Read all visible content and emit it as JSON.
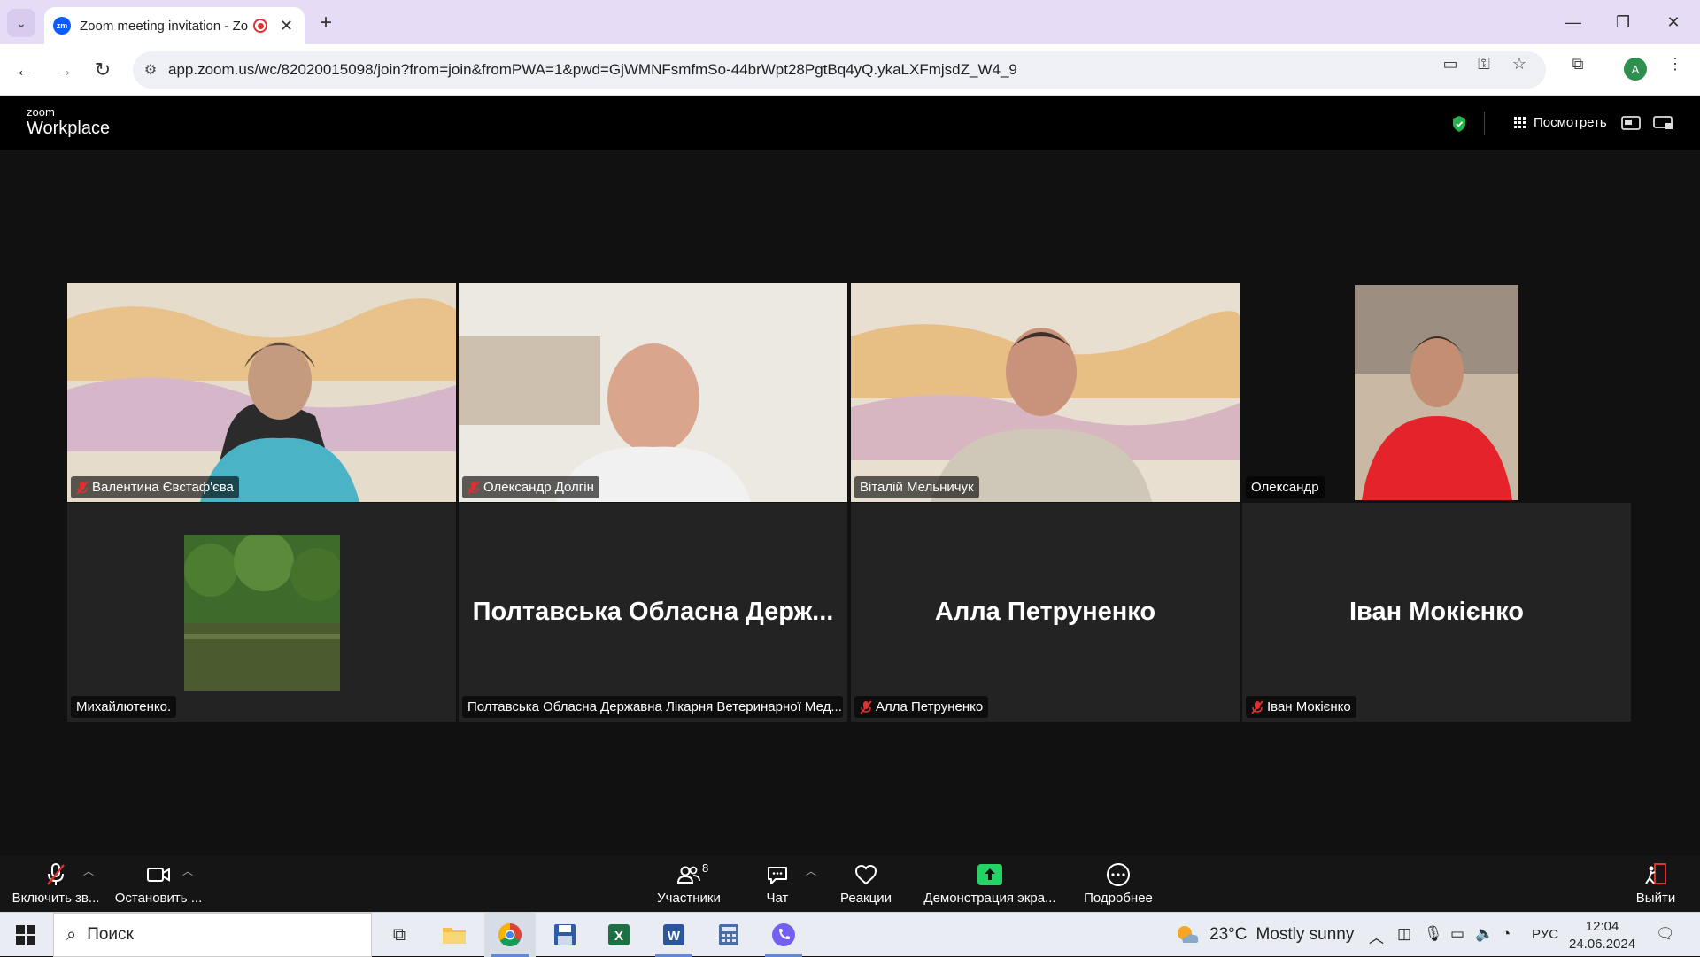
{
  "browser": {
    "tab_title": "Zoom meeting invitation - Zoom",
    "tab_favicon": "zm",
    "url": "app.zoom.us/wc/82020015098/join?from=join&fromPWA=1&pwd=GjWMNFsmfmSo-44brWpt28PgtBq4yQ.ykaLXFmjsdZ_W4_9",
    "profile_initial": "A"
  },
  "zoom_header": {
    "logo_line1": "zoom",
    "logo_line2": "Workplace",
    "view_label": "Посмотреть"
  },
  "participants_grid": [
    {
      "name": "Валентина Євстаф'єва",
      "muted": true,
      "video": "woman"
    },
    {
      "name": "Олександр Долгін",
      "muted": true,
      "video": "man-bald"
    },
    {
      "name": "Віталій Мельничук",
      "muted": false,
      "video": "man-shirt"
    },
    {
      "name": "Олександр",
      "muted": false,
      "video": "man-red",
      "active_speaker": true
    },
    {
      "name": "Михайлютенко.",
      "muted": false,
      "video": "forest-avatar"
    },
    {
      "name": "Полтавська Обласна Державна Лікарня Ветеринарної Мед...",
      "display_name": "Полтавська Обласна Держ...",
      "muted": false,
      "video": "none"
    },
    {
      "name": "Алла Петруненко",
      "display_name": "Алла Петруненко",
      "muted": true,
      "video": "none"
    },
    {
      "name": "Іван Мокієнко",
      "display_name": "Іван Мокієнко",
      "muted": true,
      "video": "none"
    }
  ],
  "zoom_bar": {
    "unmute_label": "Включить зв...",
    "video_label": "Остановить ...",
    "participants_label": "Участники",
    "participants_count": "8",
    "chat_label": "Чат",
    "reactions_label": "Реакции",
    "share_label": "Демонстрация экра...",
    "more_label": "Подробнее",
    "leave_label": "Выйти"
  },
  "taskbar": {
    "search_label": "Поиск",
    "weather_temp": "23°C",
    "weather_text": "Mostly sunny",
    "language": "РУС",
    "time": "12:04",
    "date": "24.06.2024"
  },
  "colors": {
    "tab_strip": "#e7dcf5",
    "active_speaker_border": "#d2e38e",
    "mute_red": "#e0302f",
    "shield_green": "#22b14c",
    "share_green": "#23d366"
  }
}
